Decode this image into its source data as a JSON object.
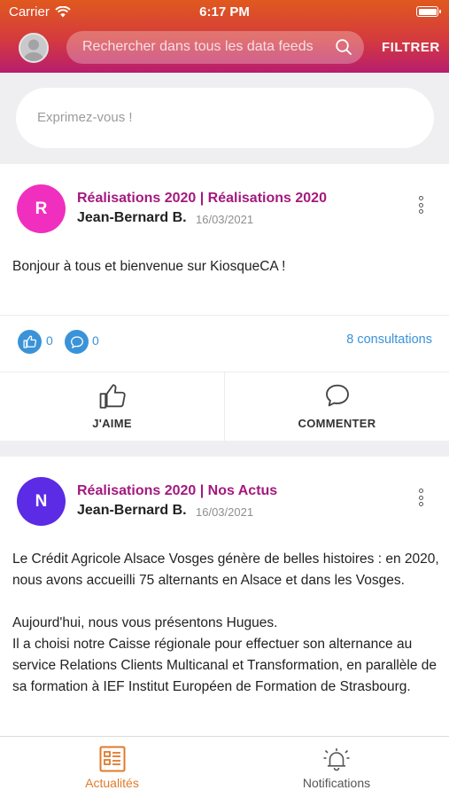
{
  "status_bar": {
    "carrier": "Carrier",
    "time": "6:17 PM"
  },
  "header": {
    "search_placeholder": "Rechercher dans tous les data feeds",
    "filter_label": "FILTRER"
  },
  "compose": {
    "placeholder": "Exprimez-vous !"
  },
  "posts": [
    {
      "avatar_letter": "R",
      "avatar_color": "#f02fbf",
      "title": "Réalisations 2020 | Réalisations 2020",
      "author": "Jean-Bernard B.",
      "date": "16/03/2021",
      "body": [
        "Bonjour à tous et bienvenue sur KiosqueCA !"
      ],
      "likes": "0",
      "comments": "0",
      "views": "8 consultations",
      "like_label": "J'AIME",
      "comment_label": "COMMENTER"
    },
    {
      "avatar_letter": "N",
      "avatar_color": "#5b2be6",
      "title": "Réalisations 2020 | Nos Actus",
      "author": "Jean-Bernard B.",
      "date": "16/03/2021",
      "body": [
        "Le Crédit Agricole Alsace Vosges génère de belles histoires : en 2020, nous avons accueilli 75 alternants en Alsace et dans les Vosges.",
        "Aujourd'hui, nous vous présentons Hugues.",
        "Il a choisi notre Caisse régionale pour effectuer son alternance au service Relations Clients Multicanal et Transformation, en parallèle de sa formation à IEF Institut Européen de Formation de Strasbourg."
      ]
    }
  ],
  "tabbar": {
    "news_label": "Actualités",
    "notifications_label": "Notifications",
    "active_color": "#e07a2a"
  }
}
